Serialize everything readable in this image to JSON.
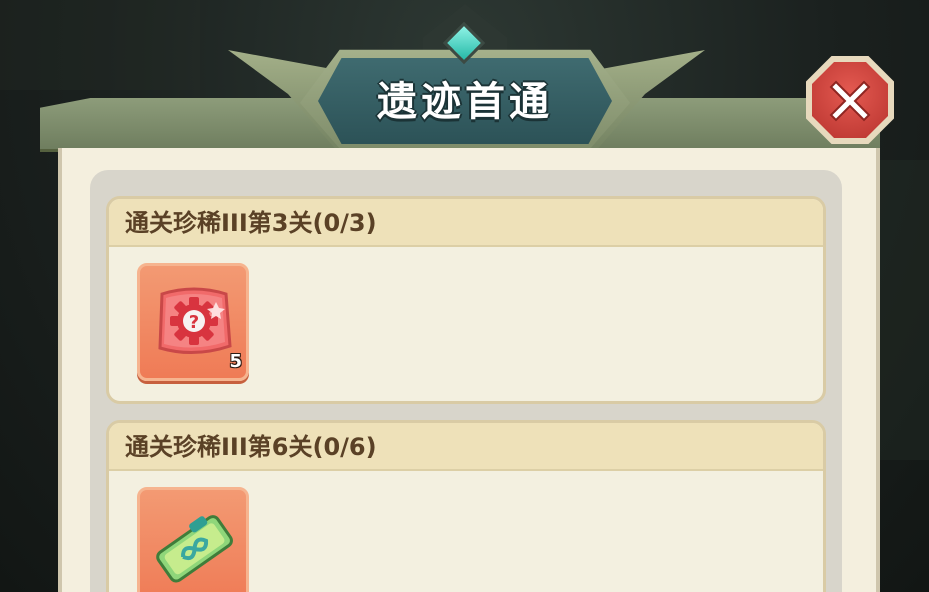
{
  "dialog": {
    "title": "遗迹首通",
    "close_icon": "close-x-icon"
  },
  "tasks": [
    {
      "label": "通关珍稀III第3关(0/3)",
      "reward": {
        "icon": "mystery-gear-scroll-icon",
        "count": "5"
      }
    },
    {
      "label": "通关珍稀III第6关(0/6)",
      "reward": {
        "icon": "jade-ticket-icon",
        "count": ""
      }
    }
  ],
  "colors": {
    "banner_plate": "#2c5257",
    "close_button": "#d0403a",
    "reward_tile": "#ef7b56",
    "card_header": "#eee1b9",
    "card_text": "#5a4126"
  }
}
